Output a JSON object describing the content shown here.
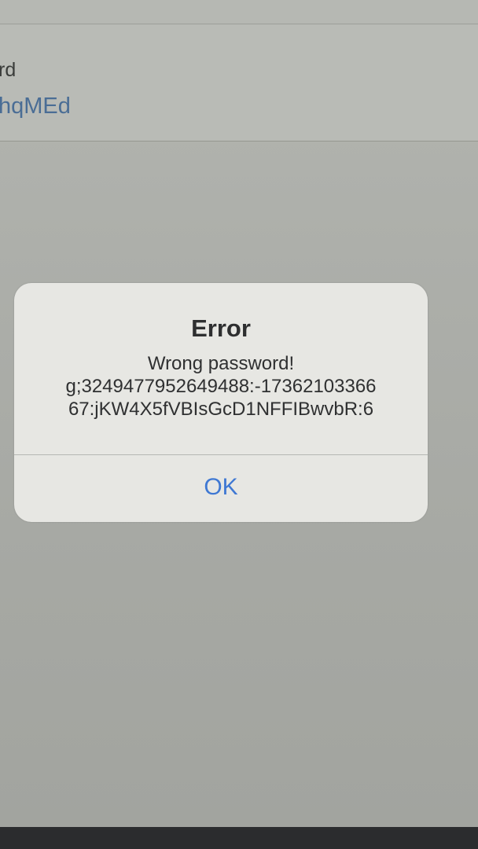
{
  "field": {
    "label": "rd",
    "value": "hqMEd"
  },
  "alert": {
    "title": "Error",
    "message_lines": [
      "Wrong password!",
      "g;3249477952649488:-17362103366",
      "67:jKW4X5fVBIsGcD1NFFIBwvbR:6"
    ],
    "ok_label": "OK"
  },
  "colors": {
    "accent": "#3f78d3",
    "field_value": "#4a6d95"
  }
}
